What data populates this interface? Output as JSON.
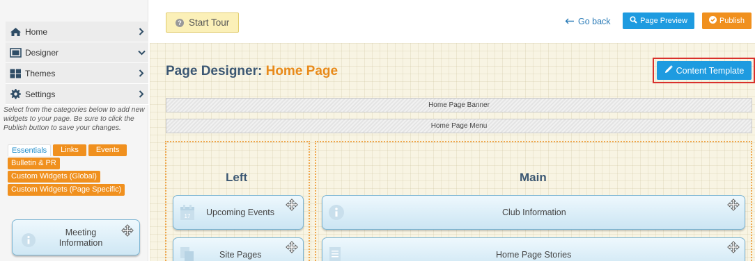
{
  "sidebar": {
    "menu": [
      {
        "label": "Home",
        "icon": "home-icon",
        "chevron": "chevron-right-icon"
      },
      {
        "label": "Designer",
        "icon": "designer-icon",
        "chevron": "chevron-down-icon"
      },
      {
        "label": "Themes",
        "icon": "themes-icon",
        "chevron": "chevron-right-icon"
      },
      {
        "label": "Settings",
        "icon": "gear-icon",
        "chevron": "chevron-right-icon"
      }
    ],
    "help_text": "Select from the categories below to add new widgets to your page. Be sure to click the Publish button to save your changes.",
    "tabs": [
      "Essentials",
      "Links",
      "Events",
      "Bulletin & PR",
      "Custom Widgets (Global)",
      "Custom Widgets (Page Specific)"
    ],
    "active_tab": "Essentials",
    "widget": {
      "label": "Meeting Information",
      "icon": "info-icon"
    }
  },
  "topbar": {
    "start_tour": "Start Tour",
    "go_back": "Go back",
    "page_preview": "Page Preview",
    "publish": "Publish"
  },
  "designer": {
    "title_prefix": "Page Designer:",
    "title_page": "Home Page",
    "content_template": "Content Template",
    "banner": "Home Page Banner",
    "menu": "Home Page Menu",
    "regions": {
      "left": {
        "title": "Left",
        "widgets": [
          {
            "label": "Upcoming Events",
            "icon": "calendar-icon"
          },
          {
            "label": "Site Pages",
            "icon": "pages-icon"
          }
        ]
      },
      "main": {
        "title": "Main",
        "widgets": [
          {
            "label": "Club Information",
            "icon": "info-icon"
          },
          {
            "label": "Home Page Stories",
            "icon": "document-icon"
          }
        ]
      }
    }
  },
  "colors": {
    "accent_blue": "#1e9be0",
    "accent_orange": "#f0901e",
    "heading": "#3b5773",
    "highlight": "#d9302b"
  }
}
